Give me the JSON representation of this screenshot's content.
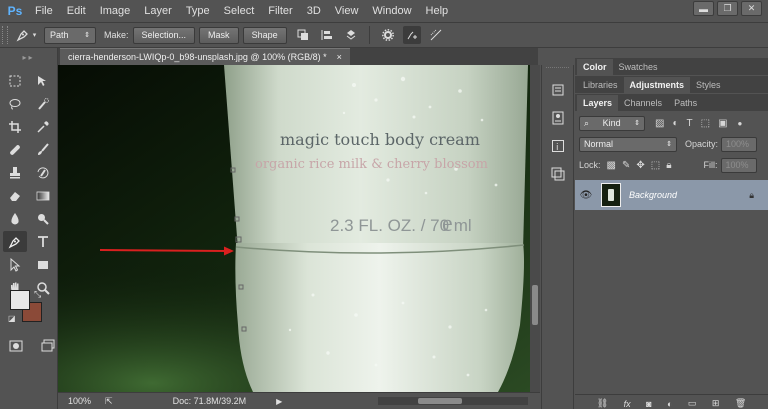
{
  "app": {
    "logo": "Ps"
  },
  "menu": [
    "File",
    "Edit",
    "Image",
    "Layer",
    "Type",
    "Select",
    "Filter",
    "3D",
    "View",
    "Window",
    "Help"
  ],
  "window_controls": {
    "minimize": "▬",
    "restore": "❐",
    "close": "✕"
  },
  "options_bar": {
    "mode_value": "Path",
    "make_label": "Make:",
    "selection_button": "Selection...",
    "mask_button": "Mask",
    "shape_button": "Shape"
  },
  "document": {
    "tab_title": "cierra-henderson-LWIQp-0_b98-unsplash.jpg @ 100% (RGB/8) *",
    "close_glyph": "×",
    "zoom": "100%",
    "doc_size": "Doc: 71.8M/39.2M"
  },
  "canvas_image": {
    "product_line1": "magic touch body cream",
    "product_line2": "organic rice milk & cherry blossom",
    "product_line3": "2.3 FL. OZ. / 70 ml",
    "product_mark": "e"
  },
  "panels": {
    "top_tabs": [
      "Color",
      "Swatches"
    ],
    "mid_tabs": [
      "Libraries",
      "Adjustments",
      "Styles"
    ],
    "layer_tabs": [
      "Layers",
      "Channels",
      "Paths"
    ],
    "kind_label": "Kind",
    "blend_mode": "Normal",
    "opacity_label": "Opacity:",
    "opacity_value": "100%",
    "lock_label": "Lock:",
    "fill_label": "Fill:",
    "fill_value": "100%",
    "layer_name": "Background"
  },
  "colors": {
    "foreground": "#e8e8e8",
    "background": "#8b4a38",
    "selected_layer": "#8b98a9",
    "annotation_arrow": "#d9201f"
  },
  "icons": {
    "tools": [
      "move-icon",
      "marquee-icon",
      "lasso-icon",
      "quick-select-icon",
      "crop-icon",
      "eyedropper-icon",
      "healing-brush-icon",
      "brush-icon",
      "clone-stamp-icon",
      "history-brush-icon",
      "eraser-icon",
      "gradient-icon",
      "blur-icon",
      "dodge-icon",
      "pen-icon",
      "type-icon",
      "path-selection-icon",
      "rectangle-shape-icon",
      "hand-icon",
      "zoom-icon"
    ]
  }
}
